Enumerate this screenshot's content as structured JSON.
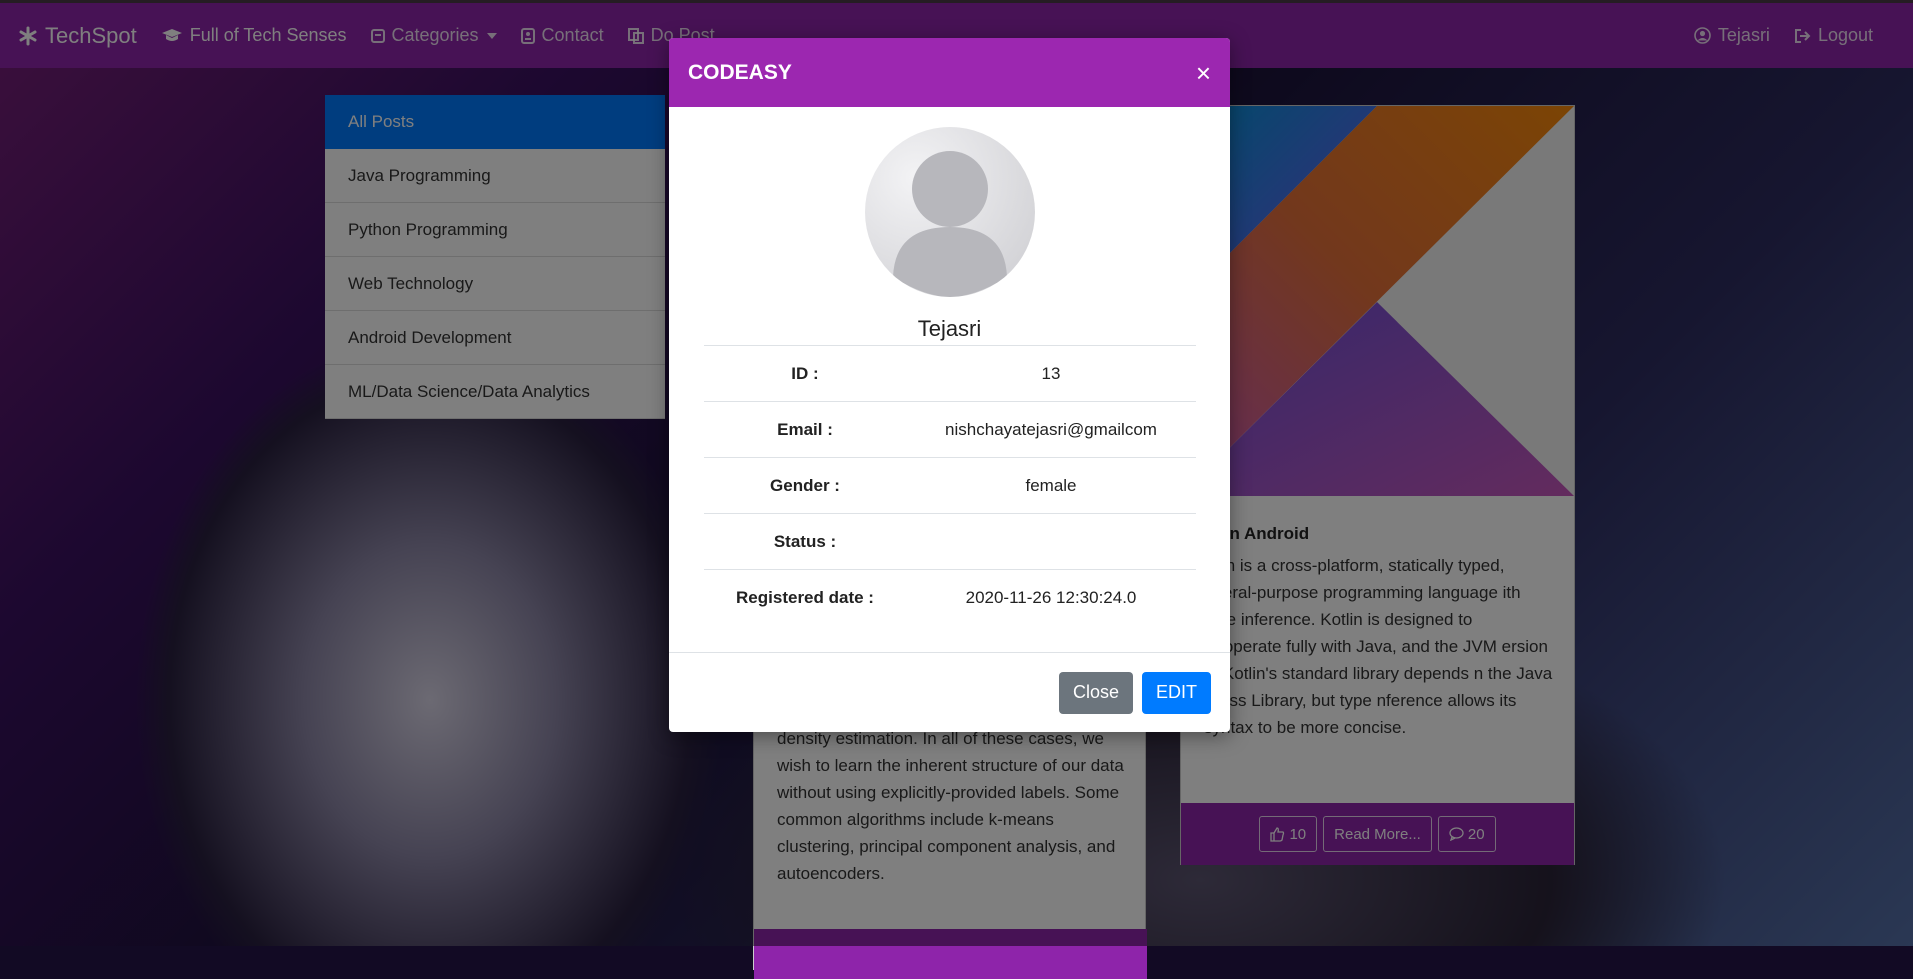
{
  "navbar": {
    "brand": "TechSpot",
    "items": [
      {
        "label": "Full of Tech Senses",
        "icon": "graduation-cap-icon"
      },
      {
        "label": "Categories",
        "icon": "category-icon"
      },
      {
        "label": "Contact",
        "icon": "contact-icon"
      },
      {
        "label": "Do Post",
        "icon": "copy-icon"
      }
    ],
    "user": "Tejasri",
    "logout": "Logout"
  },
  "categories": [
    "All Posts",
    "Java Programming",
    "Python Programming",
    "Web Technology",
    "Android Development",
    "ML/Data Science/Data Analytics"
  ],
  "post_right": {
    "title": "otlin Android",
    "body": "otlin is a cross-platform, statically typed, eneral-purpose programming language ith type inference. Kotlin is designed to teroperate fully with Java, and the JVM ersion of Kotlin's standard library depends n the Java Class Library, but type nference allows its syntax to be more concise.",
    "likes": "10",
    "read_more": "Read More...",
    "comments": "20"
  },
  "post_mid": {
    "body": "density estimation. In all of these cases, we wish to learn the inherent structure of our data without using explicitly-provided labels. Some common algorithms include k-means clustering, principal component analysis, and autoencoders."
  },
  "modal": {
    "title": "CODEASY",
    "close_x": "×",
    "username": "Tejasri",
    "rows": [
      {
        "key": "ID :",
        "value": "13"
      },
      {
        "key": "Email :",
        "value": "nishchayatejasri@gmailcom"
      },
      {
        "key": "Gender :",
        "value": "female"
      },
      {
        "key": "Status :",
        "value": ""
      },
      {
        "key": "Registered date :",
        "value": "2020-11-26 12:30:24.0"
      }
    ],
    "close_button": "Close",
    "edit_button": "EDIT"
  },
  "colors": {
    "navbar": "#8e24aa",
    "modal_header": "#9c27b0",
    "primary": "#007bff",
    "secondary": "#6c757d"
  }
}
